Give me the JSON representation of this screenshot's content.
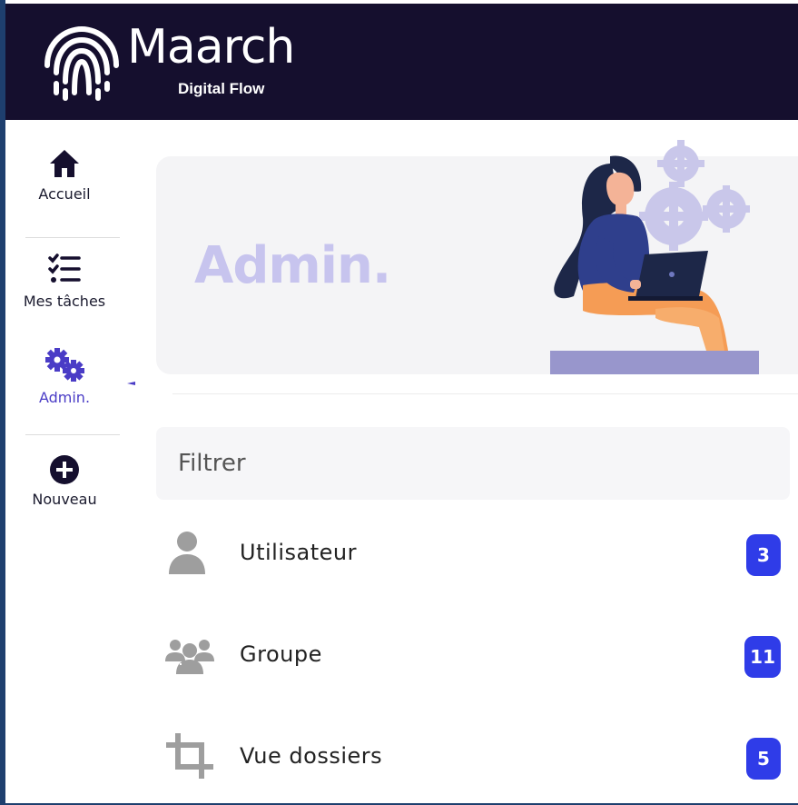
{
  "app": {
    "brand_name": "Maarch",
    "brand_sub": "Digital Flow"
  },
  "sidebar": {
    "items": [
      {
        "label": "Accueil",
        "icon": "home-icon"
      },
      {
        "label": "Mes tâches",
        "icon": "task-list-icon"
      },
      {
        "label": "Admin.",
        "icon": "gears-icon",
        "active": true
      },
      {
        "label": "Nouveau",
        "icon": "plus-circle-icon"
      }
    ]
  },
  "hero": {
    "title": "Admin."
  },
  "filter": {
    "placeholder": "Filtrer",
    "value": ""
  },
  "admin_list": {
    "rows": [
      {
        "label": "Utilisateur",
        "count": "3",
        "icon": "user-icon"
      },
      {
        "label": "Groupe",
        "count": "11",
        "icon": "group-icon"
      },
      {
        "label": "Vue dossiers",
        "count": "5",
        "icon": "crop-icon"
      }
    ]
  },
  "colors": {
    "topbar": "#150f2e",
    "accent": "#4a3cc6",
    "badge": "#2f3ce8",
    "hero_title": "#c7c4ee"
  }
}
